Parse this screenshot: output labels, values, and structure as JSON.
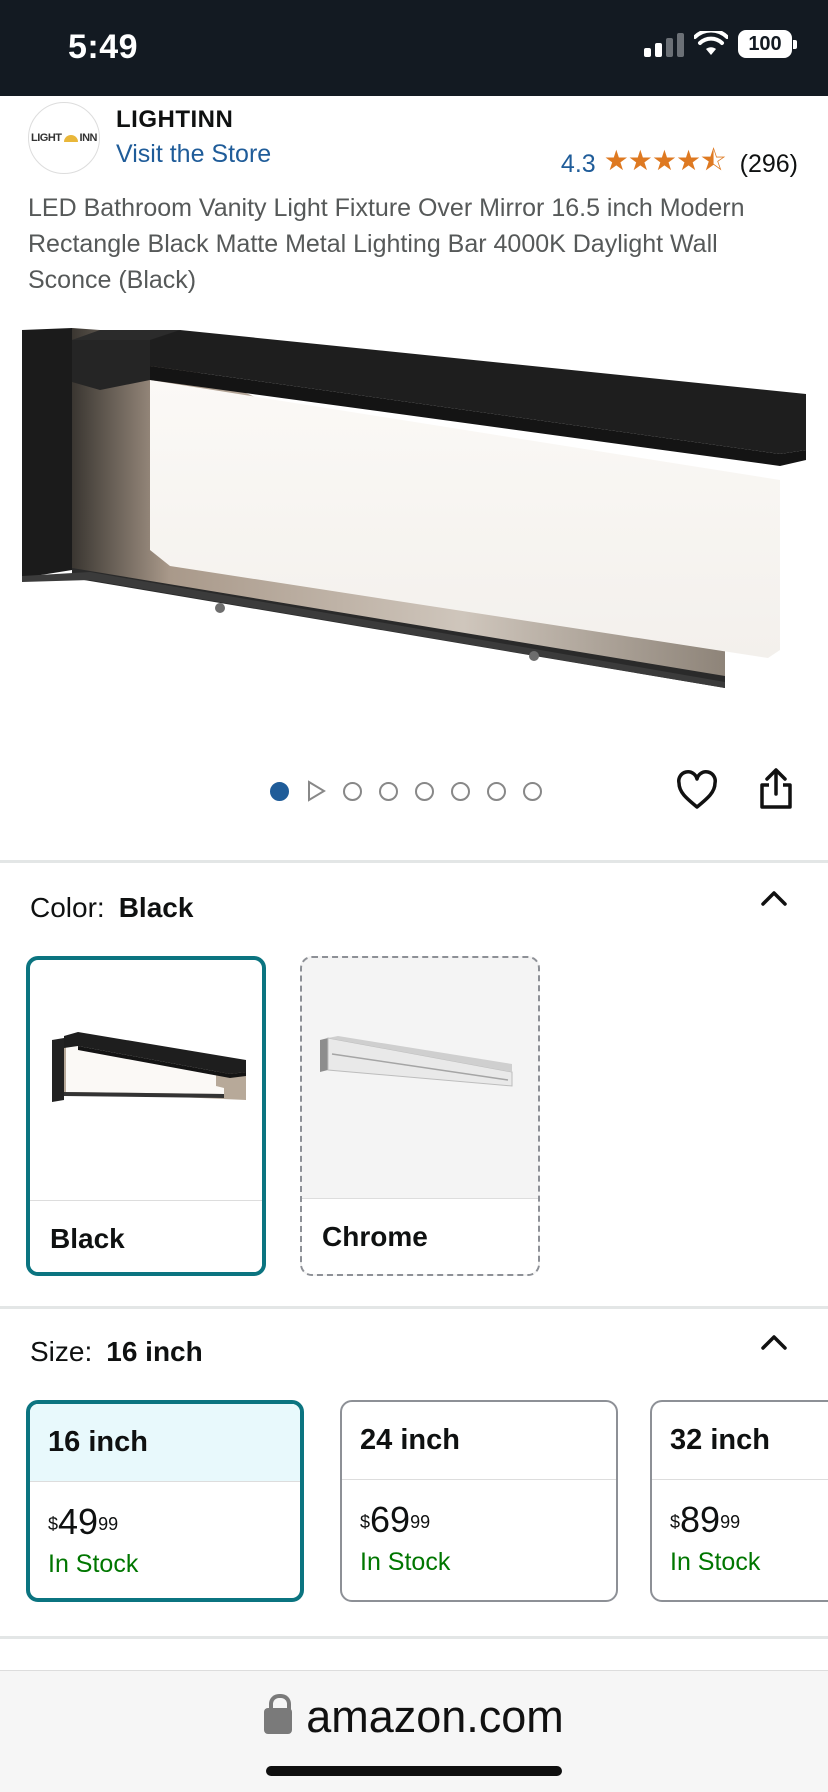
{
  "status_bar": {
    "time": "5:49",
    "battery": "100"
  },
  "brand": {
    "logo_text_left": "LIGHT",
    "logo_text_right": "INN",
    "name": "LIGHTINN",
    "visit_store": "Visit the Store"
  },
  "rating": {
    "value": "4.3",
    "stars": "★★★★⯪",
    "reviews": "(296)",
    "star_color": "#de7921"
  },
  "product": {
    "title": "LED Bathroom Vanity Light Fixture Over Mirror 16.5 inch Modern Rectangle Black Matte Metal Lighting Bar 4000K Daylight Wall Sconce (Black)"
  },
  "gallery": {
    "image_count": 8,
    "active_index": 0,
    "second_is_video": true
  },
  "color": {
    "label": "Color:",
    "selected": "Black",
    "options": [
      {
        "name": "Black",
        "selected": true,
        "available": true
      },
      {
        "name": "Chrome",
        "selected": false,
        "available": false
      }
    ]
  },
  "size": {
    "label": "Size:",
    "selected": "16 inch",
    "options": [
      {
        "name": "16 inch",
        "currency": "$",
        "whole": "49",
        "fraction": "99",
        "stock": "In Stock",
        "selected": true
      },
      {
        "name": "24 inch",
        "currency": "$",
        "whole": "69",
        "fraction": "99",
        "stock": "In Stock",
        "selected": false
      },
      {
        "name": "32 inch",
        "currency": "$",
        "whole": "89",
        "fraction": "99",
        "stock": "In Stock",
        "selected": false
      }
    ]
  },
  "browser": {
    "url": "amazon.com"
  },
  "colors": {
    "accent_teal": "#0b7480",
    "link_blue": "#1f5c99",
    "stock_green": "#007600",
    "status_bar_bg": "#131a22"
  }
}
